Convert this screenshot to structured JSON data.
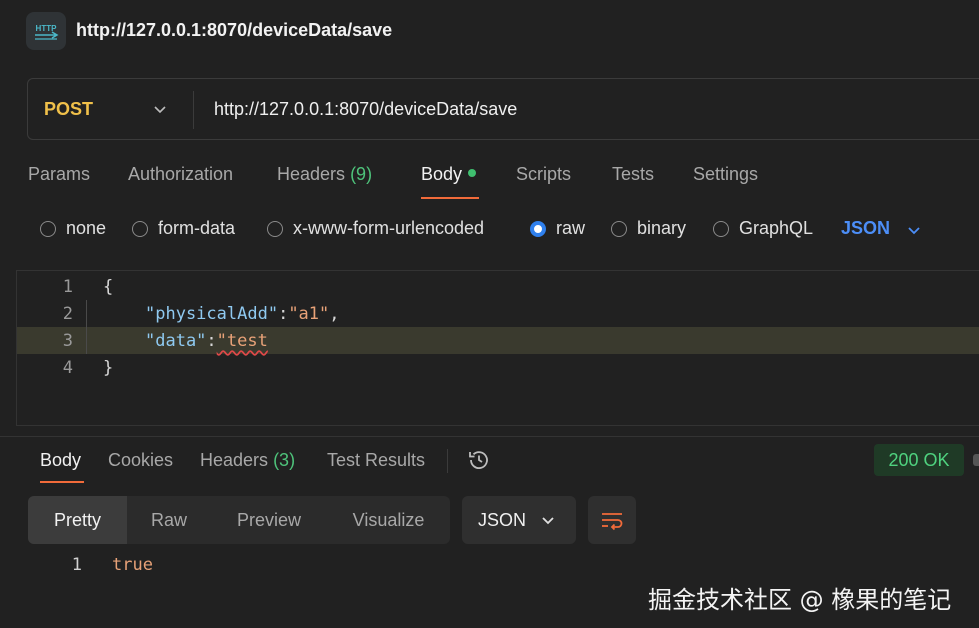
{
  "header": {
    "badge_icon": "http-icon",
    "title": "http://127.0.0.1:8070/deviceData/save"
  },
  "request": {
    "method": "POST",
    "url": "http://127.0.0.1:8070/deviceData/save",
    "tabs": [
      {
        "label": "Params"
      },
      {
        "label": "Authorization"
      },
      {
        "label": "Headers",
        "count": "(9)"
      },
      {
        "label": "Body",
        "active": true
      },
      {
        "label": "Scripts"
      },
      {
        "label": "Tests"
      },
      {
        "label": "Settings"
      }
    ],
    "body_types": [
      "none",
      "form-data",
      "x-www-form-urlencoded",
      "raw",
      "binary",
      "GraphQL"
    ],
    "selected_body_type": "raw",
    "language": "JSON",
    "code_lines": [
      {
        "num": "1",
        "open": "{"
      },
      {
        "num": "2",
        "key": "\"physicalAdd\"",
        "colon": ":",
        "value": "\"a1\"",
        "comma": ","
      },
      {
        "num": "3",
        "key": "\"data\"",
        "colon": ":",
        "value": "\"test"
      },
      {
        "num": "4",
        "close": "}"
      }
    ]
  },
  "response": {
    "tabs": [
      {
        "label": "Body",
        "active": true
      },
      {
        "label": "Cookies"
      },
      {
        "label": "Headers",
        "count": "(3)"
      },
      {
        "label": "Test Results"
      }
    ],
    "status": "200 OK",
    "views": [
      "Pretty",
      "Raw",
      "Preview",
      "Visualize"
    ],
    "format": "JSON",
    "lines": [
      {
        "num": "1",
        "text": "true"
      }
    ]
  },
  "watermark": "掘金技术社区 @ 橡果的笔记",
  "colors": {
    "method": "#f0c04a",
    "accent": "#f26b3a",
    "link": "#4c8ef7",
    "success": "#4fd27f"
  }
}
